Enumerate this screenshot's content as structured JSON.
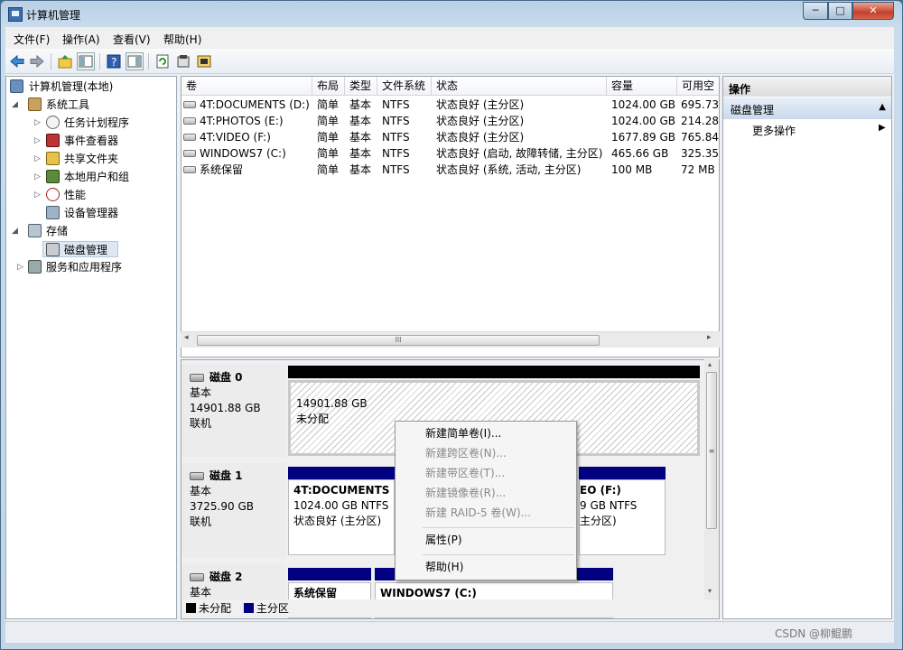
{
  "window": {
    "title": "计算机管理",
    "min": "─",
    "max": "□",
    "close": "✕"
  },
  "menu": [
    "文件(F)",
    "操作(A)",
    "查看(V)",
    "帮助(H)"
  ],
  "tree": [
    {
      "label": "计算机管理(本地)",
      "icon": "computer-icon"
    },
    {
      "label": "系统工具",
      "icon": "tools-icon"
    },
    {
      "label": "任务计划程序",
      "icon": "clock-icon"
    },
    {
      "label": "事件查看器",
      "icon": "event-viewer-icon"
    },
    {
      "label": "共享文件夹",
      "icon": "shared-folder-icon"
    },
    {
      "label": "本地用户和组",
      "icon": "users-icon"
    },
    {
      "label": "性能",
      "icon": "performance-icon"
    },
    {
      "label": "设备管理器",
      "icon": "device-manager-icon"
    },
    {
      "label": "存储",
      "icon": "storage-icon"
    },
    {
      "label": "磁盘管理",
      "icon": "disk-management-icon"
    },
    {
      "label": "服务和应用程序",
      "icon": "services-icon"
    }
  ],
  "volumes": {
    "headers": [
      "卷",
      "布局",
      "类型",
      "文件系统",
      "状态",
      "容量",
      "可用空"
    ],
    "rows": [
      [
        "4T:DOCUMENTS (D:)",
        "简单",
        "基本",
        "NTFS",
        "状态良好 (主分区)",
        "1024.00 GB",
        "695.73"
      ],
      [
        "4T:PHOTOS (E:)",
        "简单",
        "基本",
        "NTFS",
        "状态良好 (主分区)",
        "1024.00 GB",
        "214.28"
      ],
      [
        "4T:VIDEO (F:)",
        "简单",
        "基本",
        "NTFS",
        "状态良好 (主分区)",
        "1677.89 GB",
        "765.84"
      ],
      [
        "WINDOWS7 (C:)",
        "简单",
        "基本",
        "NTFS",
        "状态良好 (启动, 故障转储, 主分区)",
        "465.66 GB",
        "325.35"
      ],
      [
        "系统保留",
        "简单",
        "基本",
        "NTFS",
        "状态良好 (系统, 活动, 主分区)",
        "100 MB",
        "72 MB"
      ]
    ],
    "hscroll_grip": "III"
  },
  "disks": [
    {
      "name": "磁盘 0",
      "type": "基本",
      "size": "14901.88 GB",
      "status": "联机",
      "partitions": [
        {
          "size": "14901.88 GB",
          "status": "未分配"
        }
      ]
    },
    {
      "name": "磁盘 1",
      "type": "基本",
      "size": "3725.90 GB",
      "status": "联机",
      "partitions": [
        {
          "name": "4T:DOCUMENTS (",
          "size": "1024.00 GB NTFS",
          "status": "状态良好 (主分区)"
        },
        {
          "name": "EO  (F:)",
          "size": "9 GB NTFS",
          "status": "主分区)"
        }
      ]
    },
    {
      "name": "磁盘 2",
      "type": "基本",
      "partitions": [
        {
          "name": "系统保留"
        },
        {
          "name": "WINDOWS7  (C:)"
        }
      ]
    }
  ],
  "legend": {
    "unallocated": "未分配",
    "primary": "主分区"
  },
  "actions": {
    "header": "操作",
    "selected": "磁盘管理",
    "more": "更多操作"
  },
  "context_menu": {
    "items": [
      {
        "label": "新建简单卷(I)...",
        "enabled": true
      },
      {
        "label": "新建跨区卷(N)...",
        "enabled": false
      },
      {
        "label": "新建带区卷(T)...",
        "enabled": false
      },
      {
        "label": "新建镜像卷(R)...",
        "enabled": false
      },
      {
        "label": "新建 RAID-5 卷(W)...",
        "enabled": false
      },
      {
        "label": "属性(P)",
        "enabled": true
      },
      {
        "label": "帮助(H)",
        "enabled": true
      }
    ]
  },
  "watermark": "CSDN @柳鲲鹏",
  "colors": {
    "unallocated": "#000000",
    "primary": "#000080",
    "selection": "#c9d9ec"
  }
}
